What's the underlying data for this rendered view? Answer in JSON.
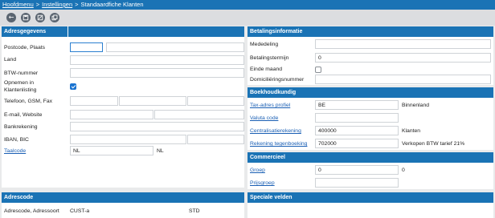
{
  "breadcrumb": {
    "home": "Hoofdmenu",
    "settings": "Instellingen",
    "current": "Standaardfiche Klanten",
    "separator": ">"
  },
  "toolbar": {
    "back": "back-icon",
    "save": "save-icon",
    "save_close": "save-close-icon",
    "copy": "copy-icon"
  },
  "address": {
    "title": "Adresgegevens",
    "postcode_label": "Postcode, Plaats",
    "land_label": "Land",
    "btw_label": "BTW-nummer",
    "klantenlisting_label_1": "Opnemen in",
    "klantenlisting_label_2": "Klantenlisting",
    "klantenlisting_checked": true,
    "phone_label": "Telefoon, GSM, Fax",
    "email_label": "E-mail, Website",
    "bank_label": "Bankrekening",
    "iban_label": "IBAN, BIC",
    "taalcode_label": "Taalcode",
    "taalcode_value": "NL",
    "taalcode_desc": "NL"
  },
  "payment": {
    "title": "Betalingsinformatie",
    "mededeling_label": "Mededeling",
    "termijn_label": "Betalingstermijn",
    "termijn_value": "0",
    "einde_maand_label": "Einde maand",
    "einde_maand_checked": false,
    "domicilie_label": "Domiciliëringsnummer"
  },
  "accounting": {
    "title": "Boekhoudkundig",
    "tax_label": "Tax-adres profiel",
    "tax_value": "BE",
    "tax_desc": "Binnenland",
    "valuta_label": "Valuta code",
    "central_label": "Centralisatierekening",
    "central_value": "400000",
    "central_desc": "Klanten",
    "tegen_label": "Rekening tegenboeking",
    "tegen_value": "702000",
    "tegen_desc": "Verkopen BTW tarief 21%"
  },
  "commercial": {
    "title": "Commercieel",
    "groep_label": "Groep",
    "groep_value": "0",
    "groep_desc": "0",
    "prijsgroep_label": "Prijsgroep"
  },
  "adrescode": {
    "title": "Adrescode",
    "label": "Adrescode, Adressoort",
    "code": "CUST-a",
    "soort": "STD"
  },
  "special": {
    "title": "Speciale velden"
  }
}
